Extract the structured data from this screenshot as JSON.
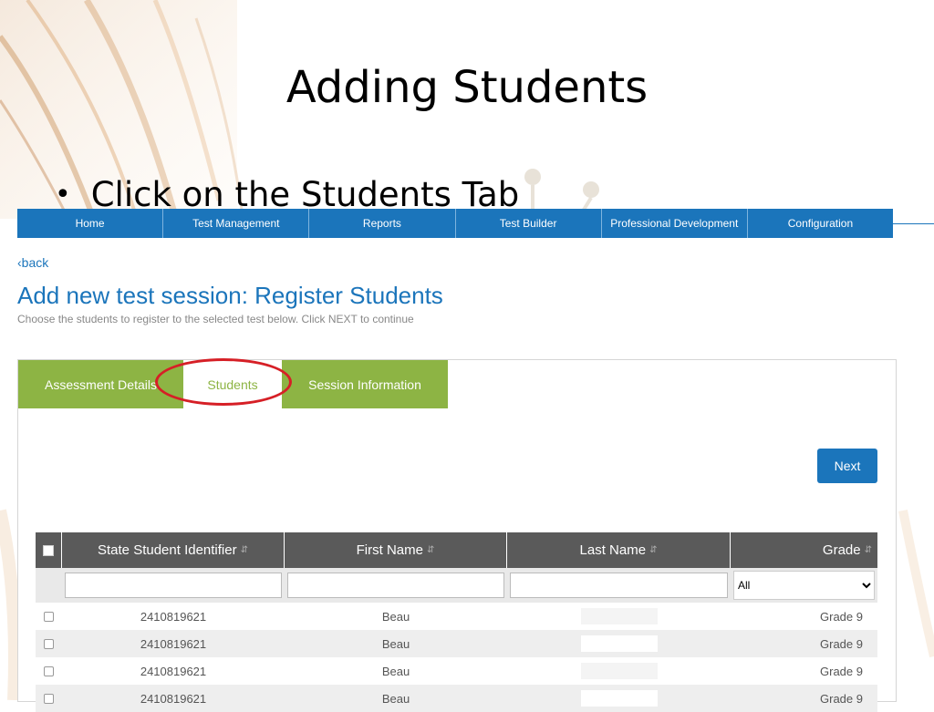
{
  "slide": {
    "title": "Adding Students",
    "bullet": "Click on the Students Tab"
  },
  "nav": {
    "items": [
      "Home",
      "Test Management",
      "Reports",
      "Test Builder",
      "Professional Development",
      "Configuration"
    ]
  },
  "back_label": "‹back",
  "heading": "Add new test session: Register Students",
  "subheading": "Choose the students to register to the selected test below. Click NEXT to continue",
  "tabs": [
    {
      "label": "Assessment Details"
    },
    {
      "label": "Students"
    },
    {
      "label": "Session Information"
    }
  ],
  "active_tab": "Students",
  "next_label": "Next",
  "table": {
    "columns": [
      "State Student Identifier",
      "First Name",
      "Last Name",
      "Grade"
    ],
    "sort_icon": "sort-arrows-icon",
    "grade_filter": "All",
    "rows": [
      {
        "id": "2410819621",
        "first": "Beau",
        "grade": "Grade 9"
      },
      {
        "id": "2410819621",
        "first": "Beau",
        "grade": "Grade 9"
      },
      {
        "id": "2410819621",
        "first": "Beau",
        "grade": "Grade 9"
      },
      {
        "id": "2410819621",
        "first": "Beau",
        "grade": "Grade 9"
      }
    ]
  },
  "colors": {
    "nav_blue": "#1b75bb",
    "tab_green": "#8db444",
    "table_header": "#5a5a5a",
    "highlight_red": "#d61f26"
  }
}
